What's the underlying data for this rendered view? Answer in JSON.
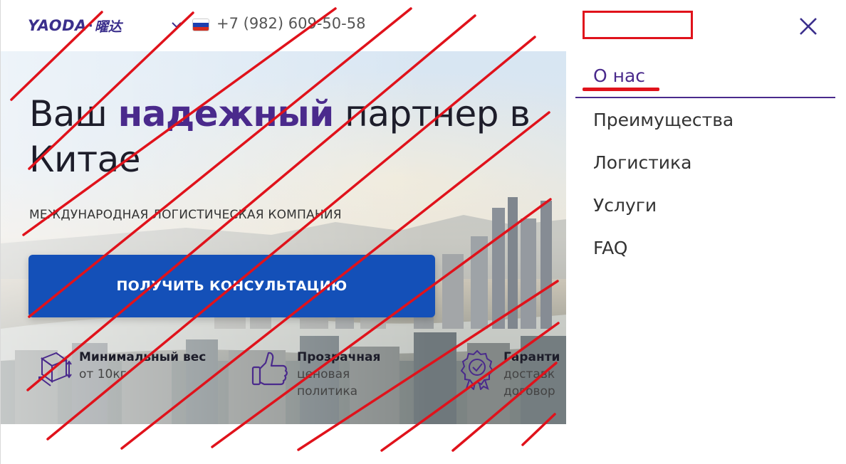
{
  "header": {
    "logo_latin": "YAODA",
    "logo_separator": "·",
    "logo_cn": "曜达",
    "phone": "+7 (982) 609-50-58",
    "country_flag": "flag-russia-icon",
    "language_dropdown_icon": "chevron-down-icon"
  },
  "hero": {
    "title_before": "Ваш ",
    "title_accent": "надежный",
    "title_after": " партнер в Китае",
    "subtitle": "МЕЖДУНАРОДНАЯ ЛОГИСТИЧЕСКАЯ КОМПАНИЯ",
    "cta_label": "ПОЛУЧИТЬ КОНСУЛЬТАЦИЮ"
  },
  "features": [
    {
      "icon": "box-weight-icon",
      "title": "Минимальный вес",
      "sub1": "от 10кг",
      "sub2": ""
    },
    {
      "icon": "thumbs-up-icon",
      "title": "",
      "sub0": "Прозрачная",
      "sub1": "ценовая",
      "sub2": "политика"
    },
    {
      "icon": "guarantee-badge-icon",
      "title": "",
      "sub0": "Гаранти",
      "sub1": "доставк",
      "sub2": "договор"
    }
  ],
  "menu": {
    "close_icon": "close-icon",
    "items": [
      {
        "label": "О нас",
        "active": true
      },
      {
        "label": "Преимущества",
        "active": false
      },
      {
        "label": "Логистика",
        "active": false
      },
      {
        "label": "Услуги",
        "active": false
      },
      {
        "label": "FAQ",
        "active": false
      }
    ]
  },
  "colors": {
    "brand_purple": "#4a2a8c",
    "logo_purple": "#3b2f8c",
    "cta_blue": "#1450b8",
    "annotation_red": "#e0121b"
  }
}
